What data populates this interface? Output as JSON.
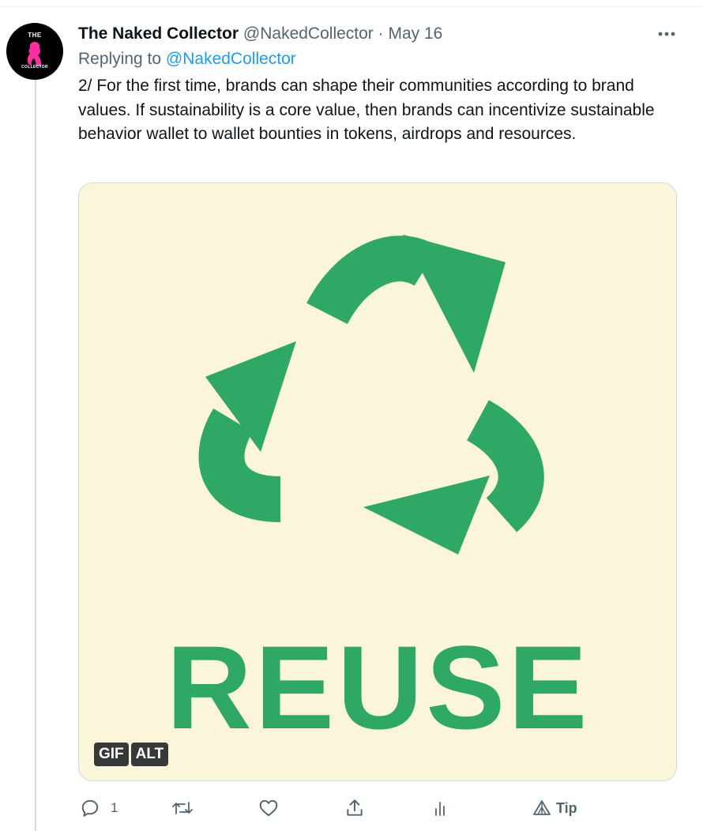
{
  "tweet": {
    "author_name": "The Naked Collector",
    "author_handle": "@NakedCollector",
    "separator": "·",
    "date": "May 16",
    "more_icon": "more-horizontal-icon",
    "reply_prefix": "Replying to",
    "reply_handle": "@NakedCollector",
    "text": "2/ For the first time, brands can shape their communities according to brand values. If sustainability is a core value, then brands can incentivize sustainable behavior wallet to wallet bounties in tokens, airdrops and resources."
  },
  "avatar": {
    "top_text": "THE",
    "bottom_text": "COLLECTOR",
    "background": "#000000",
    "figure_color": "#ff2fa3"
  },
  "media": {
    "image_text": "REUSE",
    "badge_gif": "GIF",
    "badge_alt": "ALT",
    "background": "#fbf5d9",
    "symbol_color": "#2fa866"
  },
  "actions": {
    "reply_icon": "reply-icon",
    "reply_count": "1",
    "retweet_icon": "retweet-icon",
    "like_icon": "heart-icon",
    "share_icon": "share-icon",
    "analytics_icon": "analytics-icon",
    "tip_icon": "tip-icon",
    "tip_label": "Tip"
  },
  "colors": {
    "text": "#0f1419",
    "muted": "#536471",
    "link": "#1d9bf0",
    "thread_line": "#cfd9de"
  }
}
